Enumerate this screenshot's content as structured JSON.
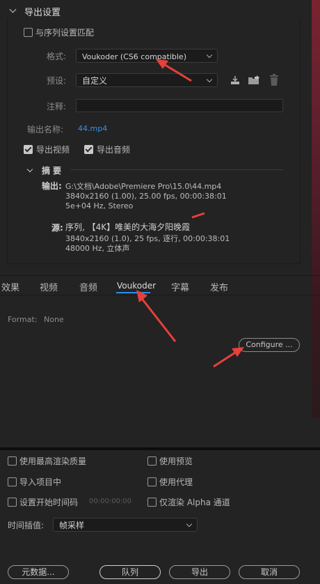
{
  "export_settings": {
    "section_title": "导出设置",
    "match_sequence_label": "与序列设置匹配",
    "format_label": "格式:",
    "format_value": "Voukoder (CS6 compatible)",
    "preset_label": "预设:",
    "preset_value": "自定义",
    "comment_label": "注释:",
    "output_name_label": "输出名称:",
    "output_name_value": "44.mp4",
    "export_video_label": "导出视频",
    "export_audio_label": "导出音频"
  },
  "summary": {
    "title": "摘要",
    "output_label": "输出:",
    "output_lines": [
      "G:\\文档\\Adobe\\Premiere Pro\\15.0\\44.mp4",
      "3840x2160 (1.00), 25.00 fps, 00:00:38:01",
      "5e+04 Hz, Stereo"
    ],
    "source_label": "源:",
    "source_lines": [
      "序列, 【4K】唯美的大海夕阳晚霞",
      "3840x2160 (1.0), 25 fps, 逐行, 00:00:38:01",
      "48000 Hz, 立体声"
    ]
  },
  "tabs": {
    "items": [
      "效果",
      "视频",
      "音频",
      "Voukoder",
      "字幕",
      "发布"
    ],
    "active": "Voukoder"
  },
  "voukoder_panel": {
    "format_label": "Format:",
    "format_value": "None",
    "configure_button": "Configure ..."
  },
  "options": {
    "max_render_quality": "使用最高渲染质量",
    "use_previews": "使用预览",
    "import_into_project": "导入项目中",
    "use_proxies": "使用代理",
    "set_start_timecode": "设置开始时间码",
    "start_timecode_value": "00:00:00:00",
    "render_alpha_only": "仅渲染 Alpha 通道",
    "time_interpolation_label": "时间插值:",
    "time_interpolation_value": "帧采样"
  },
  "footer": {
    "metadata_button": "元数据...",
    "queue_button": "队列",
    "export_button": "导出",
    "cancel_button": "取消"
  },
  "colors": {
    "accent_blue": "#2d8ceb",
    "link_blue": "#3d8ee6",
    "annotation_red": "#e8403a"
  }
}
